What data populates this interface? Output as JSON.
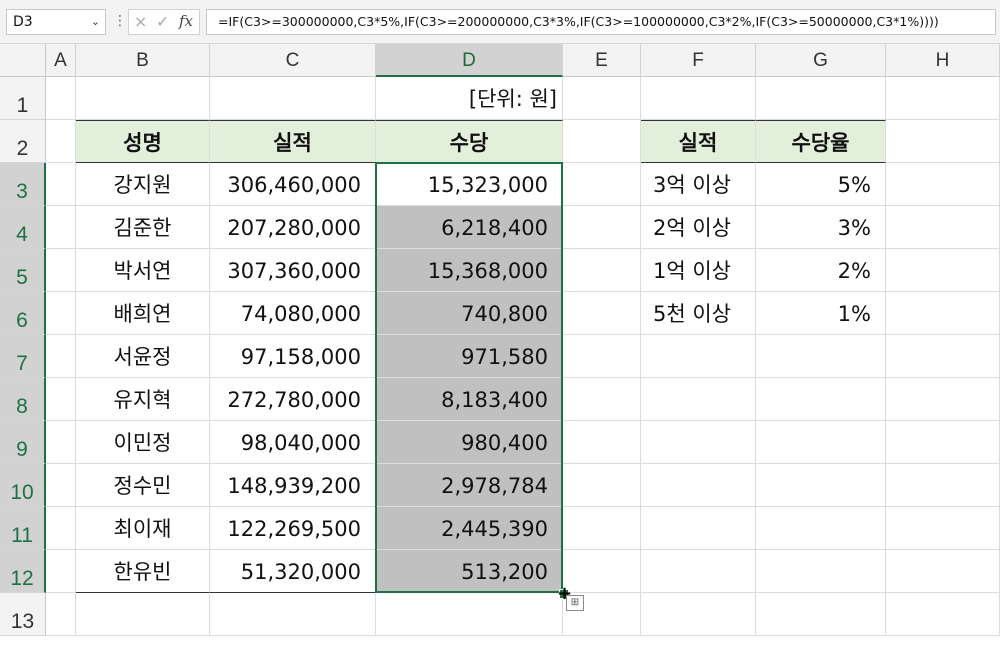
{
  "formula_bar": {
    "name_box": "D3",
    "name_box_arrow": "⌄",
    "separator": "⋮",
    "cancel_icon": "×",
    "enter_icon": "✓",
    "fx_label": "fx",
    "formula": "=IF(C3>=300000000,C3*5%,IF(C3>=200000000,C3*3%,IF(C3>=100000000,C3*2%,IF(C3>=50000000,C3*1%))))"
  },
  "columns": [
    "A",
    "B",
    "C",
    "D",
    "E",
    "F",
    "G",
    "H"
  ],
  "rows": [
    "1",
    "2",
    "3",
    "4",
    "5",
    "6",
    "7",
    "8",
    "9",
    "10",
    "11",
    "12",
    "13"
  ],
  "unit_label": "[단위: 원]",
  "main_table": {
    "headers": [
      "성명",
      "실적",
      "수당"
    ],
    "rows": [
      [
        "강지원",
        "306,460,000",
        "15,323,000"
      ],
      [
        "김준한",
        "207,280,000",
        "6,218,400"
      ],
      [
        "박서연",
        "307,360,000",
        "15,368,000"
      ],
      [
        "배희연",
        "74,080,000",
        "740,800"
      ],
      [
        "서윤정",
        "97,158,000",
        "971,580"
      ],
      [
        "유지혁",
        "272,780,000",
        "8,183,400"
      ],
      [
        "이민정",
        "98,040,000",
        "980,400"
      ],
      [
        "정수민",
        "148,939,200",
        "2,978,784"
      ],
      [
        "최이재",
        "122,269,500",
        "2,445,390"
      ],
      [
        "한유빈",
        "51,320,000",
        "513,200"
      ]
    ]
  },
  "rate_table": {
    "headers": [
      "실적",
      "수당율"
    ],
    "rows": [
      [
        "3억 이상",
        "5%"
      ],
      [
        "2억 이상",
        "3%"
      ],
      [
        "1억 이상",
        "2%"
      ],
      [
        "5천 이상",
        "1%"
      ]
    ]
  },
  "fill_cursor": "+",
  "quick_analysis_icon": "⊞",
  "colors": {
    "selection": "#1e7145",
    "header_fill": "#e2efda",
    "filled_range": "#c0c0c0"
  }
}
